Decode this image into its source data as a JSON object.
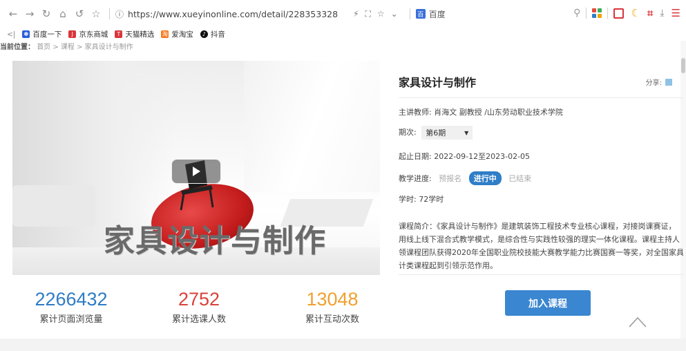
{
  "browser": {
    "url": "https://www.xueyinonline.com/detail/228353328",
    "search_engine": "百度",
    "bookmarks": [
      {
        "label": "百度一下",
        "color": "#2b5fd9"
      },
      {
        "label": "京东商城",
        "color": "#d9343a"
      },
      {
        "label": "天猫精选",
        "color": "#d9343a"
      },
      {
        "label": "爱淘宝",
        "color": "#f57a1f"
      },
      {
        "label": "抖音",
        "color": "#111111"
      }
    ]
  },
  "breadcrumb": {
    "prefix": "当前位置：",
    "path": "首页 > 课程 > 家具设计与制作"
  },
  "hero": {
    "title": "家具设计与制作"
  },
  "stats": [
    {
      "value": "2266432",
      "label": "累计页面浏览量",
      "color": "#2e7cc4"
    },
    {
      "value": "2752",
      "label": "累计选课人数",
      "color": "#d9423a"
    },
    {
      "value": "13048",
      "label": "累计互动次数",
      "color": "#f0a030"
    }
  ],
  "course": {
    "title": "家具设计与制作",
    "share_label": "分享:",
    "teacher": "主讲教师: 肖海文 副教授 /山东劳动职业技术学院",
    "term_label": "期次:",
    "term_value": "第6期",
    "dates": "起止日期: 2022-09-12至2023-02-05",
    "progress_label": "教学进度:",
    "progress_states": [
      "预报名",
      "进行中",
      "已结束"
    ],
    "progress_active": "进行中",
    "hours": "学时: 72学时",
    "intro_lines": [
      "课程简介：《家具设计与制作》是建筑装饰工程技术专业核心课程，对接岗课赛证，",
      "用线上线下混合式教学模式，是综合性与实践性较强的理实一体化课程。课程主持人",
      "领课程团队获得2020年全国职业院校技能大赛教学能力比赛国赛一等奖，对全国家具",
      "计类课程起到引领示范作用。"
    ],
    "join_label": "加入课程"
  }
}
